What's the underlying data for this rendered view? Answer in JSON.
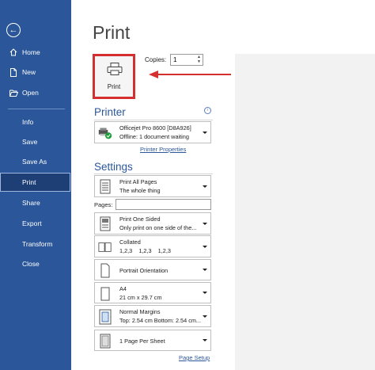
{
  "sidebar": {
    "items": [
      {
        "label": "Home",
        "icon": "home-icon"
      },
      {
        "label": "New",
        "icon": "new-document-icon"
      },
      {
        "label": "Open",
        "icon": "folder-open-icon"
      },
      {
        "label": "Info"
      },
      {
        "label": "Save"
      },
      {
        "label": "Save As"
      },
      {
        "label": "Print",
        "active": true
      },
      {
        "label": "Share"
      },
      {
        "label": "Export"
      },
      {
        "label": "Transform"
      },
      {
        "label": "Close"
      }
    ]
  },
  "page": {
    "title": "Print"
  },
  "print_button": {
    "label": "Print"
  },
  "copies": {
    "label": "Copies:",
    "value": "1"
  },
  "printer": {
    "heading": "Printer",
    "name": "Officejet Pro 8600 [D8A926]",
    "status": "Offline: 1 document waiting",
    "properties_link": "Printer Properties"
  },
  "settings": {
    "heading": "Settings",
    "print_range": {
      "line1": "Print All Pages",
      "line2": "The whole thing"
    },
    "pages_label": "Pages:",
    "pages_value": "",
    "sides": {
      "line1": "Print One Sided",
      "line2": "Only print on one side of the..."
    },
    "collation": {
      "line1": "Collated",
      "line2": "1,2,3    1,2,3    1,2,3"
    },
    "orientation": {
      "line1": "Portrait Orientation"
    },
    "paper": {
      "line1": "A4",
      "line2": "21 cm x 29.7 cm"
    },
    "margins": {
      "line1": "Normal Margins",
      "line2": "Top: 2.54 cm Bottom: 2.54 cm..."
    },
    "per_sheet": {
      "line1": "1 Page Per Sheet"
    },
    "page_setup_link": "Page Setup"
  },
  "colors": {
    "sidebar": "#2b579a",
    "active": "#1e3f76",
    "highlight": "#d62f2f",
    "accent": "#2b579a"
  }
}
